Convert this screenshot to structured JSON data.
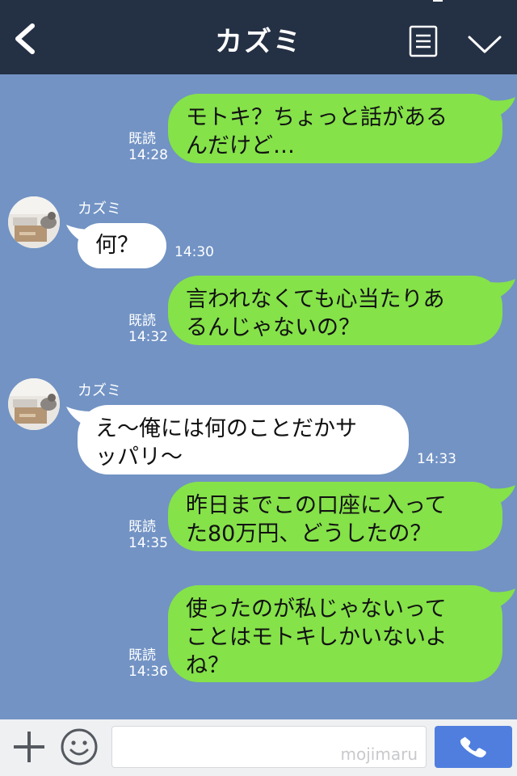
{
  "header": {
    "title": "カズミ"
  },
  "messages": [
    {
      "side": "me",
      "text_lines": [
        "モトキ？ちょっと話があるんだけど…"
      ],
      "read": "既読",
      "time": "14:28"
    },
    {
      "side": "other",
      "sender": "カズミ",
      "text": "何？",
      "time": "14:30"
    },
    {
      "side": "me",
      "text_lines": [
        "言われなくても心当たりあるんじゃないの？"
      ],
      "read": "既読",
      "time": "14:32"
    },
    {
      "side": "other",
      "sender": "カズミ",
      "text": "え〜俺には何のことだかサッパリ〜",
      "time": "14:33"
    },
    {
      "side": "me",
      "text_lines": [
        "昨日までこの口座に入ってた80万円、どうしたの？"
      ],
      "read": "既読",
      "time": "14:35"
    },
    {
      "side": "me",
      "text_lines": [
        "使ったのが私じゃないってことはモトキしかいないよね？"
      ],
      "read": "既読",
      "time": "14:36"
    }
  ],
  "msg": {
    "m1": {
      "l1": "モトキ？ちょっと話がある",
      "l2": "んだけど…",
      "read": "既読",
      "time": "14:28"
    },
    "m2": {
      "sender": "カズミ",
      "text": "何？",
      "time": "14:30"
    },
    "m3": {
      "l1": "言われなくても心当たりあ",
      "l2": "るんじゃないの？",
      "read": "既読",
      "time": "14:32"
    },
    "m4": {
      "sender": "カズミ",
      "l1": "え〜俺には何のことだかサ",
      "l2": "ッパリ〜",
      "time": "14:33"
    },
    "m5": {
      "l1": "昨日までこの口座に入って",
      "l2": "た80万円、どうしたの？",
      "read": "既読",
      "time": "14:35"
    },
    "m6": {
      "l1": "使ったのが私じゃないって",
      "l2": "ことはモトキしかいないよ",
      "l3": "ね？",
      "read": "既読",
      "time": "14:36"
    }
  },
  "input": {
    "watermark": "mojimaru"
  },
  "icons": {
    "back": "chevron-left-icon",
    "menu": "menu-icon",
    "collapse": "chevron-down-icon",
    "add": "plus-icon",
    "emoji": "smile-icon",
    "call": "phone-icon"
  },
  "colors": {
    "header_bg": "#243044",
    "chat_bg": "#7293c4",
    "my_bubble": "#85e249",
    "their_bubble": "#ffffff",
    "call_button": "#4f7ede"
  }
}
